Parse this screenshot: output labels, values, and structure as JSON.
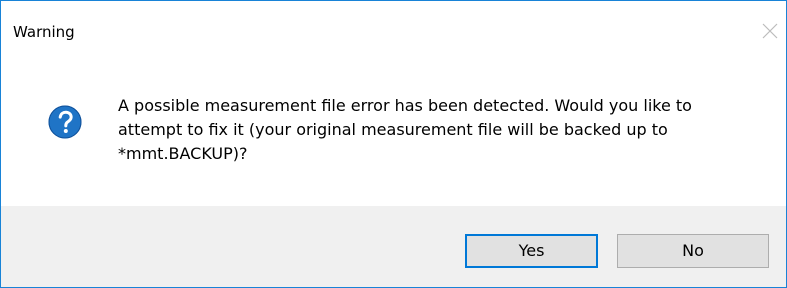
{
  "window": {
    "title": "Warning",
    "close_icon": "close-icon"
  },
  "dialog": {
    "icon": "question-icon",
    "message": "A possible measurement file error has been detected.  Would you like to\nattempt to fix it (your original measurement file will be backed up to\n*mmt.BACKUP)?",
    "buttons": {
      "yes_label": "Yes",
      "no_label": "No"
    }
  },
  "colors": {
    "accent": "#0078d7",
    "window_border": "#1883d7",
    "footer_background": "#f0f0f0",
    "button_background": "#e1e1e1",
    "question_icon": "#1f74c6"
  }
}
